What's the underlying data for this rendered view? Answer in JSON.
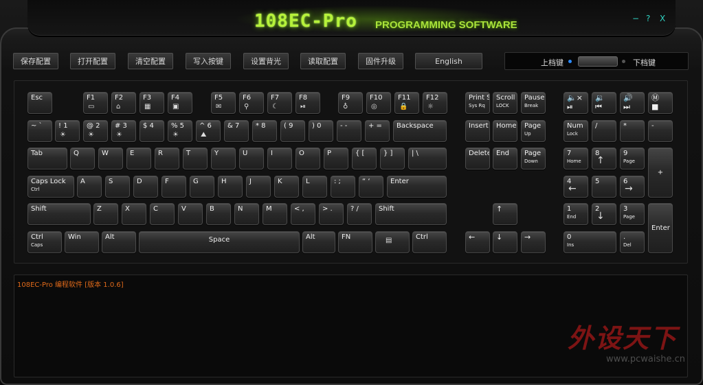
{
  "window": {
    "title_main": "108EC-Pro",
    "title_sub": "PROGRAMMING SOFTWARE",
    "controls": [
      "−",
      "?",
      "X"
    ]
  },
  "toolbar": {
    "buttons": [
      "保存配置",
      "打开配置",
      "清空配置",
      "写入按键",
      "设置背光",
      "读取配置",
      "固件升级",
      "English"
    ]
  },
  "level_switch": {
    "up_label": "上档键",
    "down_label": "下档键"
  },
  "keys": {
    "esc": [
      "Esc",
      ""
    ],
    "f1": [
      "F1",
      ""
    ],
    "f2": [
      "F2",
      ""
    ],
    "f3": [
      "F3",
      ""
    ],
    "f4": [
      "F4",
      ""
    ],
    "f5": [
      "F5",
      ""
    ],
    "f6": [
      "F6",
      ""
    ],
    "f7": [
      "F7",
      ""
    ],
    "f8": [
      "F8",
      ""
    ],
    "f9": [
      "F9",
      ""
    ],
    "f10": [
      "F10",
      ""
    ],
    "f11": [
      "F11",
      ""
    ],
    "f12": [
      "F12",
      ""
    ],
    "prtsc": [
      "Print Screen",
      "Sys Rq"
    ],
    "scroll": [
      "Scroll",
      "LOCK"
    ],
    "pause": [
      "Pause",
      "Break"
    ],
    "tilde": [
      "~ `",
      ""
    ],
    "n1": [
      "! 1",
      ""
    ],
    "n2": [
      "@ 2",
      ""
    ],
    "n3": [
      "# 3",
      ""
    ],
    "n4": [
      "$ 4",
      ""
    ],
    "n5": [
      "% 5",
      ""
    ],
    "n6": [
      "^ 6",
      ""
    ],
    "n7": [
      "& 7",
      ""
    ],
    "n8": [
      "* 8",
      ""
    ],
    "n9": [
      "( 9",
      ""
    ],
    "n0": [
      ") 0",
      ""
    ],
    "minus": [
      "- -",
      ""
    ],
    "equal": [
      "+ =",
      ""
    ],
    "backspace": [
      "Backspace",
      ""
    ],
    "insert": [
      "Insert",
      ""
    ],
    "home": [
      "Home",
      ""
    ],
    "pgup": [
      "Page",
      "Up"
    ],
    "numlock": [
      "Num",
      "Lock"
    ],
    "npdiv": [
      "/",
      ""
    ],
    "npmul": [
      "*",
      ""
    ],
    "npsub": [
      "-",
      ""
    ],
    "tab": [
      "Tab",
      ""
    ],
    "q": [
      "Q",
      ""
    ],
    "w": [
      "W",
      ""
    ],
    "e": [
      "E",
      ""
    ],
    "r": [
      "R",
      ""
    ],
    "t": [
      "T",
      ""
    ],
    "y": [
      "Y",
      ""
    ],
    "u": [
      "U",
      ""
    ],
    "i": [
      "I",
      ""
    ],
    "o": [
      "O",
      ""
    ],
    "p": [
      "P",
      ""
    ],
    "lbr": [
      "{ [",
      ""
    ],
    "rbr": [
      "} ]",
      ""
    ],
    "bslash": [
      "| \\",
      ""
    ],
    "delete": [
      "Delete",
      ""
    ],
    "end": [
      "End",
      ""
    ],
    "pgdn": [
      "Page",
      "Down"
    ],
    "np7": [
      "7",
      "Home"
    ],
    "np8": [
      "8",
      ""
    ],
    "np9": [
      "9",
      "Page"
    ],
    "npadd": [
      "+",
      ""
    ],
    "caps": [
      "Caps Lock",
      "Ctrl"
    ],
    "a": [
      "A",
      ""
    ],
    "s": [
      "S",
      ""
    ],
    "d": [
      "D",
      ""
    ],
    "f": [
      "F",
      ""
    ],
    "g": [
      "G",
      ""
    ],
    "h": [
      "H",
      ""
    ],
    "j": [
      "J",
      ""
    ],
    "k": [
      "K",
      ""
    ],
    "l": [
      "L",
      ""
    ],
    "semi": [
      ": ;",
      ""
    ],
    "quote": [
      "“ ‘",
      ""
    ],
    "enter": [
      "Enter",
      ""
    ],
    "np4": [
      "4",
      ""
    ],
    "np5": [
      "5",
      ""
    ],
    "np6": [
      "6",
      ""
    ],
    "lshift": [
      "Shift",
      ""
    ],
    "z": [
      "Z",
      ""
    ],
    "x": [
      "X",
      ""
    ],
    "c": [
      "C",
      ""
    ],
    "v": [
      "V",
      ""
    ],
    "b": [
      "B",
      ""
    ],
    "n": [
      "N",
      ""
    ],
    "m": [
      "M",
      ""
    ],
    "comma": [
      "< ,",
      ""
    ],
    "period": [
      "> .",
      ""
    ],
    "slash": [
      "? /",
      ""
    ],
    "rshift": [
      "Shift",
      ""
    ],
    "np1": [
      "1",
      "End"
    ],
    "np2": [
      "2",
      ""
    ],
    "np3": [
      "3",
      "Page"
    ],
    "npenter": [
      "Enter",
      ""
    ],
    "lctrl": [
      "Ctrl",
      "Caps"
    ],
    "win": [
      "Win",
      ""
    ],
    "lalt": [
      "Alt",
      ""
    ],
    "space": [
      "Space",
      ""
    ],
    "ralt": [
      "Alt",
      ""
    ],
    "fn": [
      "FN",
      ""
    ],
    "menu": [
      "",
      ""
    ],
    "rctrl": [
      "Ctrl",
      ""
    ],
    "np0": [
      "0",
      "Ins"
    ],
    "npdot": [
      ".",
      "Del"
    ]
  },
  "log": {
    "line": "108EC-Pro 编程软件 [版本 1.0.6]"
  },
  "watermark": {
    "text": "外设天下",
    "url": "www.pcwaishe.cn"
  }
}
